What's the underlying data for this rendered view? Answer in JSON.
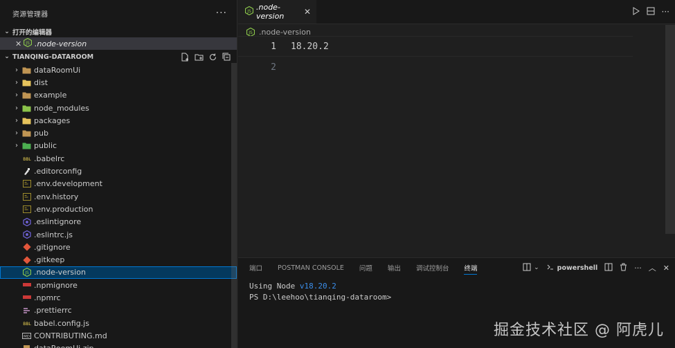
{
  "sidebar": {
    "title": "资源管理器",
    "more": "···",
    "open_editors_header": "打开的编辑器",
    "open_editors": [
      {
        "name": ".node-version"
      }
    ],
    "workspace_header": "TIANQING-DATAROOM",
    "folders": [
      {
        "name": "dataRoomUi",
        "icon": "folder-icon",
        "color": "#c09553"
      },
      {
        "name": "dist",
        "icon": "folder-dist-icon",
        "color": "#e6c35c"
      },
      {
        "name": "example",
        "icon": "folder-icon",
        "color": "#c09553"
      },
      {
        "name": "node_modules",
        "icon": "folder-node-icon",
        "color": "#8bc34a"
      },
      {
        "name": "packages",
        "icon": "folder-packages-icon",
        "color": "#e6c35c"
      },
      {
        "name": "pub",
        "icon": "folder-icon",
        "color": "#c09553"
      },
      {
        "name": "public",
        "icon": "folder-public-icon",
        "color": "#4caf50"
      }
    ],
    "files": [
      {
        "name": ".babelrc",
        "icon": "babel-icon",
        "color": "#f5da55"
      },
      {
        "name": ".editorconfig",
        "icon": "editorconfig-icon",
        "color": "#e0e0e0"
      },
      {
        "name": ".env.development",
        "icon": "env-icon",
        "color": "#9e8c2c"
      },
      {
        "name": ".env.history",
        "icon": "env-icon",
        "color": "#9e8c2c"
      },
      {
        "name": ".env.production",
        "icon": "env-icon",
        "color": "#9e8c2c"
      },
      {
        "name": ".eslintignore",
        "icon": "eslint-icon",
        "color": "#6b5fcf"
      },
      {
        "name": ".eslintrc.js",
        "icon": "eslint-icon",
        "color": "#6b5fcf"
      },
      {
        "name": ".gitignore",
        "icon": "git-icon",
        "color": "#e2563b"
      },
      {
        "name": ".gitkeep",
        "icon": "git-icon",
        "color": "#e2563b"
      },
      {
        "name": ".node-version",
        "icon": "nodejs-icon",
        "color": "#8cc84b",
        "selected": true
      },
      {
        "name": ".npmignore",
        "icon": "npm-icon",
        "color": "#cb3837"
      },
      {
        "name": ".npmrc",
        "icon": "npm-icon",
        "color": "#cb3837"
      },
      {
        "name": ".prettierrc",
        "icon": "prettier-icon",
        "color": "#c596c7"
      },
      {
        "name": "babel.config.js",
        "icon": "babel-icon",
        "color": "#f5da55"
      },
      {
        "name": "CONTRIBUTING.md",
        "icon": "markdown-icon",
        "color": "#bbbbbb"
      },
      {
        "name": "dataRoomUi.zip",
        "icon": "zip-icon",
        "color": "#c09553"
      }
    ]
  },
  "editor": {
    "tab_label": ".node-version",
    "breadcrumb": ".node-version",
    "lines": [
      {
        "num": "1",
        "text": "18.20.2"
      },
      {
        "num": "2",
        "text": ""
      }
    ]
  },
  "panel": {
    "tabs": [
      "端口",
      "POSTMAN CONSOLE",
      "问题",
      "输出",
      "调试控制台",
      "终端"
    ],
    "active_tab": "终端",
    "shell_label": "powershell",
    "terminal": {
      "line1_prefix": "Using Node ",
      "line1_version": "v18.20.2",
      "line2": "PS D:\\leehoo\\tianqing-dataroom>"
    }
  },
  "watermark": "掘金技术社区 @ 阿虎儿"
}
